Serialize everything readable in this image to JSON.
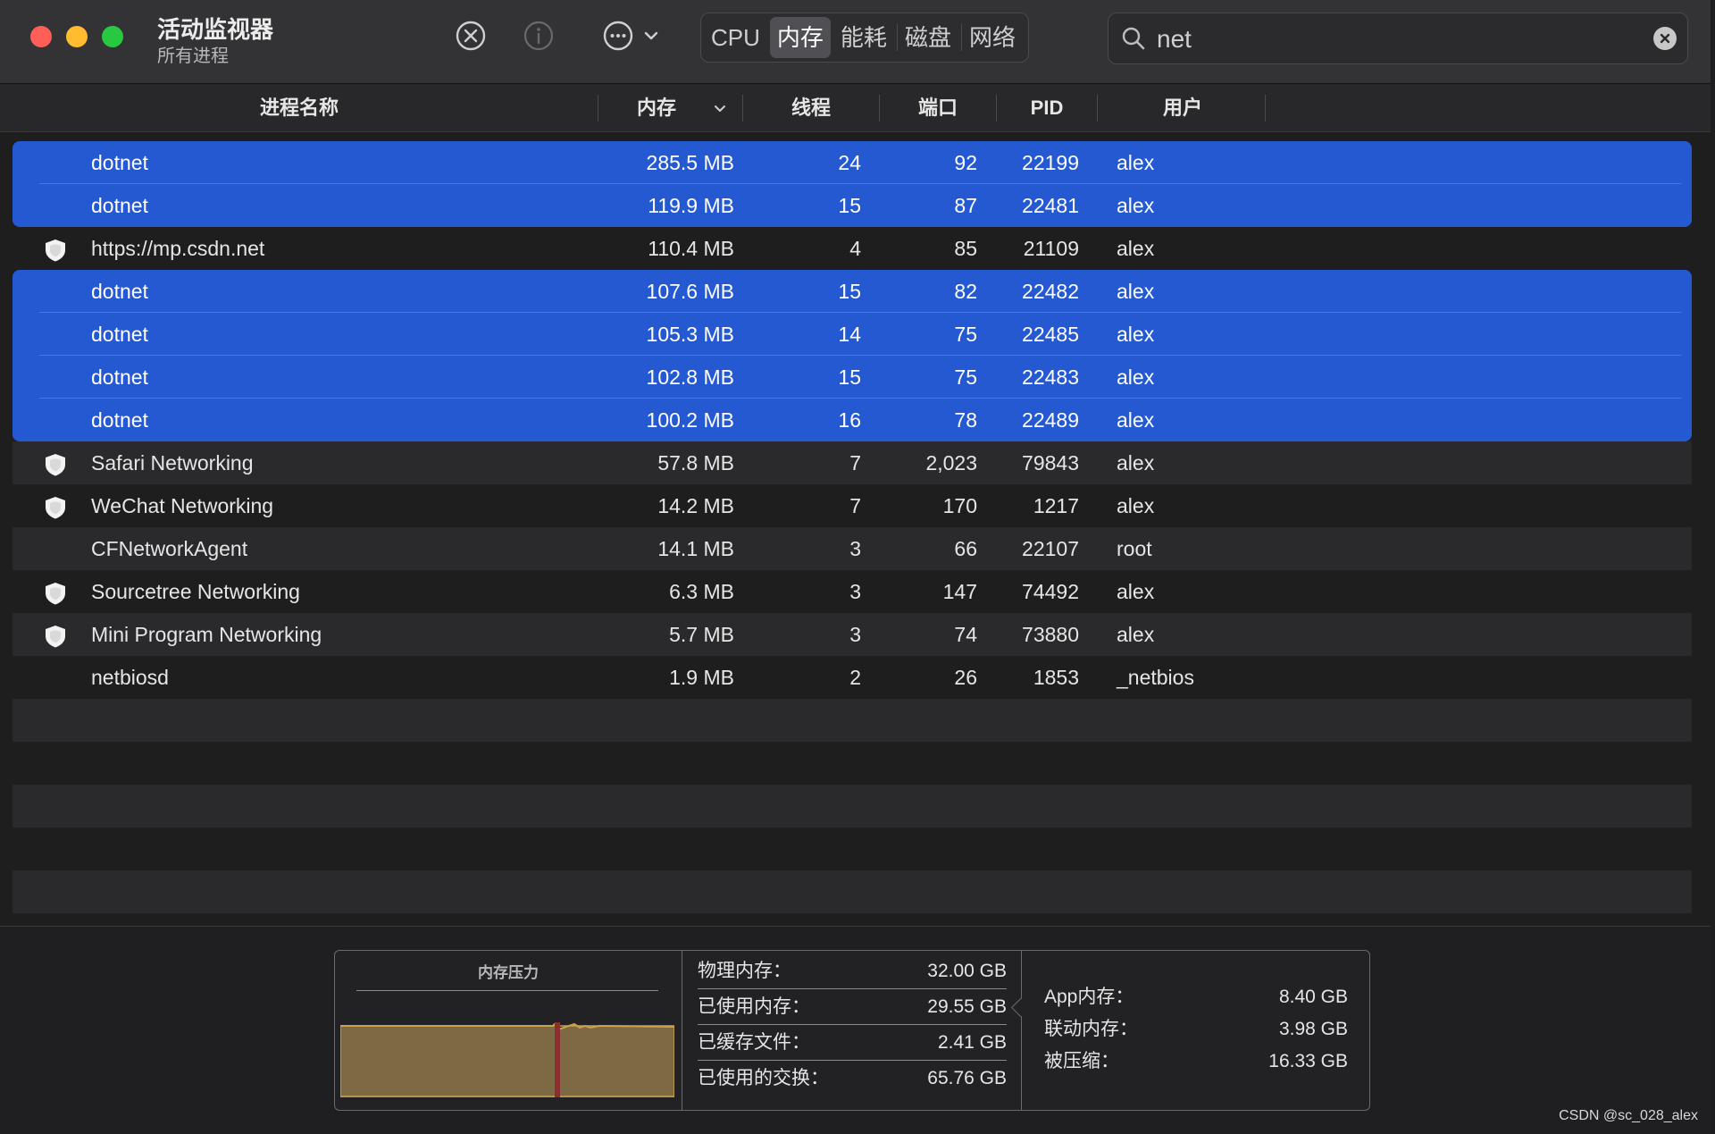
{
  "window": {
    "title": "活动监视器",
    "subtitle": "所有进程"
  },
  "toolbar": {
    "stop_icon": "stop-process-icon",
    "info_icon": "info-icon",
    "more_icon": "more-options-icon"
  },
  "tabs": [
    {
      "label": "CPU",
      "active": false
    },
    {
      "label": "内存",
      "active": true
    },
    {
      "label": "能耗",
      "active": false
    },
    {
      "label": "磁盘",
      "active": false
    },
    {
      "label": "网络",
      "active": false
    }
  ],
  "search": {
    "value": "net",
    "placeholder": "搜索"
  },
  "columns": {
    "name": "进程名称",
    "memory": "内存",
    "threads": "线程",
    "ports": "端口",
    "pid": "PID",
    "user": "用户"
  },
  "processes": [
    {
      "name": "dotnet",
      "memory": "285.5 MB",
      "threads": "24",
      "ports": "92",
      "pid": "22199",
      "user": "alex",
      "selected": true,
      "icon": ""
    },
    {
      "name": "dotnet",
      "memory": "119.9 MB",
      "threads": "15",
      "ports": "87",
      "pid": "22481",
      "user": "alex",
      "selected": true,
      "icon": ""
    },
    {
      "name": "https://mp.csdn.net",
      "memory": "110.4 MB",
      "threads": "4",
      "ports": "85",
      "pid": "21109",
      "user": "alex",
      "selected": false,
      "icon": "shield-icon"
    },
    {
      "name": "dotnet",
      "memory": "107.6 MB",
      "threads": "15",
      "ports": "82",
      "pid": "22482",
      "user": "alex",
      "selected": true,
      "icon": ""
    },
    {
      "name": "dotnet",
      "memory": "105.3 MB",
      "threads": "14",
      "ports": "75",
      "pid": "22485",
      "user": "alex",
      "selected": true,
      "icon": ""
    },
    {
      "name": "dotnet",
      "memory": "102.8 MB",
      "threads": "15",
      "ports": "75",
      "pid": "22483",
      "user": "alex",
      "selected": true,
      "icon": ""
    },
    {
      "name": "dotnet",
      "memory": "100.2 MB",
      "threads": "16",
      "ports": "78",
      "pid": "22489",
      "user": "alex",
      "selected": true,
      "icon": ""
    },
    {
      "name": "Safari Networking",
      "memory": "57.8 MB",
      "threads": "7",
      "ports": "2,023",
      "pid": "79843",
      "user": "alex",
      "selected": false,
      "icon": "shield-icon"
    },
    {
      "name": "WeChat Networking",
      "memory": "14.2 MB",
      "threads": "7",
      "ports": "170",
      "pid": "1217",
      "user": "alex",
      "selected": false,
      "icon": "shield-icon"
    },
    {
      "name": "CFNetworkAgent",
      "memory": "14.1 MB",
      "threads": "3",
      "ports": "66",
      "pid": "22107",
      "user": "root",
      "selected": false,
      "icon": ""
    },
    {
      "name": "Sourcetree Networking",
      "memory": "6.3 MB",
      "threads": "3",
      "ports": "147",
      "pid": "74492",
      "user": "alex",
      "selected": false,
      "icon": "shield-icon"
    },
    {
      "name": "Mini Program Networking",
      "memory": "5.7 MB",
      "threads": "3",
      "ports": "74",
      "pid": "73880",
      "user": "alex",
      "selected": false,
      "icon": "shield-icon"
    },
    {
      "name": "netbiosd",
      "memory": "1.9 MB",
      "threads": "2",
      "ports": "26",
      "pid": "1853",
      "user": "_netbios",
      "selected": false,
      "icon": ""
    }
  ],
  "footer": {
    "pressure_title": "内存压力",
    "stats": [
      {
        "label": "物理内存：",
        "value": "32.00 GB"
      },
      {
        "label": "已使用内存：",
        "value": "29.55 GB"
      },
      {
        "label": "已缓存文件：",
        "value": "2.41 GB"
      },
      {
        "label": "已使用的交换：",
        "value": "65.76 GB"
      }
    ],
    "stats2": [
      {
        "label": "App内存：",
        "value": "8.40 GB"
      },
      {
        "label": "联动内存：",
        "value": "3.98 GB"
      },
      {
        "label": "被压缩：",
        "value": "16.33 GB"
      }
    ]
  },
  "colors": {
    "selection": "#2459d1",
    "pressure_fill": "#7d6a44",
    "pressure_line": "#c9a24a",
    "pressure_marker": "#8b2e2e"
  },
  "watermark": "CSDN @sc_028_alex"
}
